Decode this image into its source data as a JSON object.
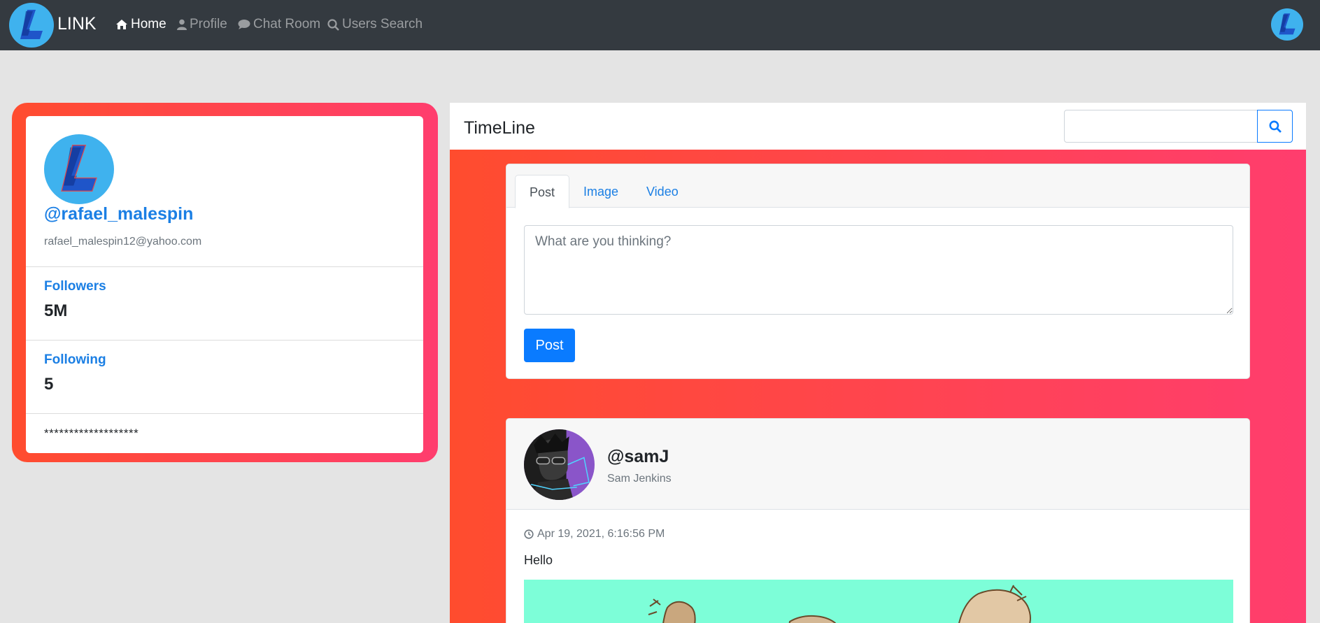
{
  "navbar": {
    "brand": "LINK",
    "links": [
      {
        "label": "Home",
        "icon": "home-icon",
        "active": true
      },
      {
        "label": "Profile",
        "icon": "user-icon",
        "active": false
      },
      {
        "label": "Chat Room",
        "icon": "comment-icon",
        "active": false
      },
      {
        "label": "Users Search",
        "icon": "search-icon",
        "active": false
      }
    ]
  },
  "profile": {
    "username": "@rafael_malespin",
    "email": "rafael_malespin12@yahoo.com",
    "followers_label": "Followers",
    "followers_value": "5M",
    "following_label": "Following",
    "following_value": "5",
    "bio": "*******************"
  },
  "timeline": {
    "title": "TimeLine",
    "search_placeholder": "",
    "composer": {
      "tabs": [
        "Post",
        "Image",
        "Video"
      ],
      "active_tab": "Post",
      "placeholder": "What are you thinking?",
      "submit_label": "Post"
    },
    "post": {
      "handle": "@samJ",
      "name": "Sam Jenkins",
      "timestamp": "Apr 19, 2021, 6:16:56 PM",
      "text": "Hello"
    }
  },
  "colors": {
    "navbar": "#343a40",
    "accent": "#1b7fe4",
    "primary_button": "#0a7bff",
    "gradient_start": "#ff4c2e",
    "gradient_end": "#ff3d6e",
    "page_bg": "#e4e4e4",
    "post_image_bg": "#7dfed8"
  }
}
